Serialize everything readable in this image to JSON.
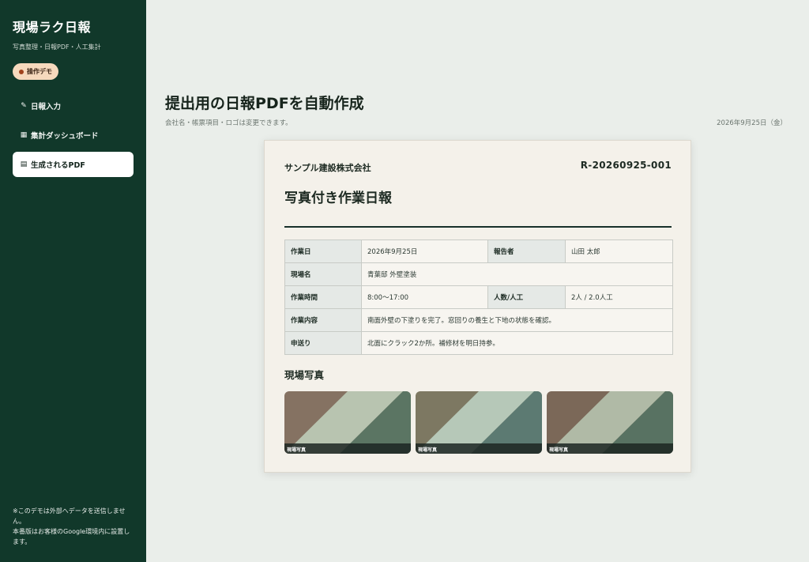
{
  "sidebar": {
    "brand": "現場ラク日報",
    "tagline": "写真整理・日報PDF・人工集計",
    "demo_badge": "操作デモ",
    "items": [
      {
        "icon": "✎",
        "label": "日報入力"
      },
      {
        "icon": "▦",
        "label": "集計ダッシュボード"
      },
      {
        "icon": "▤",
        "label": "生成されるPDF"
      }
    ],
    "note": "※このデモは外部へデータを送信しません。\n本番版はお客様のGoogle環境内に設置します。"
  },
  "header": {
    "title": "提出用の日報PDFを自動作成",
    "subtitle": "会社名・帳票項目・ロゴは変更できます。",
    "date": "2026年9月25日（金）"
  },
  "report": {
    "company": "サンプル建設株式会社",
    "number": "R-20260925-001",
    "title": "写真付き作業日報",
    "rows": {
      "work_date_label": "作業日",
      "work_date_value": "2026年9月25日",
      "reporter_label": "報告者",
      "reporter_value": "山田 太郎",
      "site_label": "現場名",
      "site_value": "青葉邸 外壁塗装",
      "hours_label": "作業時間",
      "hours_value": "8:00〜17:00",
      "staff_label": "人数/人工",
      "staff_value": "2人 / 2.0人工",
      "content_label": "作業内容",
      "content_value": "南面外壁の下塗りを完了。窓回りの養生と下地の状態を確認。",
      "handover_label": "申送り",
      "handover_value": "北面にクラック2か所。補修材を明日持参。"
    },
    "photos_heading": "現場写真",
    "photos": [
      {
        "caption": "現場写真",
        "colors": [
          "#857262",
          "#b8c4b0",
          "#5b7563"
        ]
      },
      {
        "caption": "現場写真",
        "colors": [
          "#7d7862",
          "#b6c8b8",
          "#5c7a72"
        ]
      },
      {
        "caption": "現場写真",
        "colors": [
          "#7b6858",
          "#b0baa6",
          "#587262"
        ]
      }
    ]
  },
  "colors": {
    "sidebar_bg": "#11382a",
    "main_bg": "#eaeeea",
    "badge_bg": "#f6d9bd"
  }
}
